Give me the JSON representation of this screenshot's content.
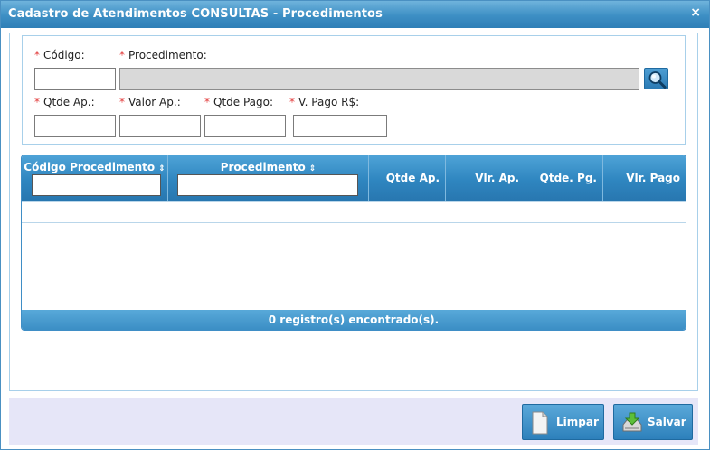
{
  "window": {
    "title": "Cadastro de Atendimentos CONSULTAS - Procedimentos",
    "close_glyph": "×"
  },
  "form": {
    "required_mark": "*",
    "codigo": {
      "label": "Código:",
      "value": ""
    },
    "procedimento": {
      "label": "Procedimento:",
      "value": ""
    },
    "qtde_ap": {
      "label": "Qtde Ap.:",
      "value": ""
    },
    "valor_ap": {
      "label": "Valor Ap.:",
      "value": ""
    },
    "qtde_pago": {
      "label": "Qtde Pago:",
      "value": ""
    },
    "v_pago": {
      "label": "V. Pago R$:",
      "value": ""
    }
  },
  "grid": {
    "columns": [
      "Código Procedimento",
      "Procedimento",
      "Qtde Ap.",
      "Vlr. Ap.",
      "Qtde. Pg.",
      "Vlr. Pago"
    ],
    "sort_glyph": "⇕",
    "filters": {
      "codigo": "",
      "procedimento": ""
    },
    "rows": [],
    "footer": "0 registro(s) encontrado(s)."
  },
  "buttons": {
    "limpar": "Limpar",
    "salvar": "Salvar"
  },
  "icons": {
    "search": "magnifier-icon",
    "close": "close-icon",
    "limpar": "blank-page-icon",
    "salvar": "disk-download-icon"
  },
  "colors": {
    "header_blue": "#2f86c0",
    "required_red": "#e23b3b",
    "bottom_bar": "#e6e6f8"
  }
}
